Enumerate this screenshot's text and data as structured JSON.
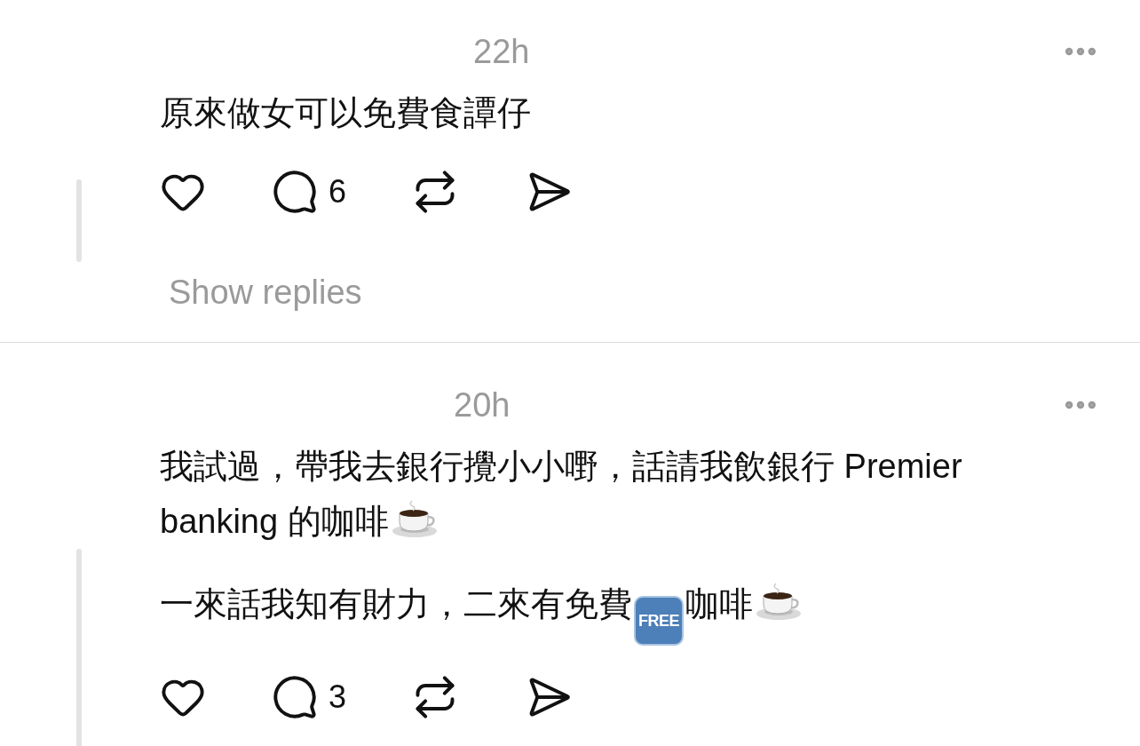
{
  "posts": [
    {
      "time": "22h",
      "paragraphs": [
        [
          [
            {
              "kind": "text",
              "text": "原來做女可以免費食譚仔"
            }
          ]
        ]
      ],
      "comments": "6",
      "show_replies": "Show replies"
    },
    {
      "time": "20h",
      "paragraphs": [
        [
          [
            {
              "kind": "text",
              "text": "我試過，帶我去銀行攪小小嘢，話請我飲銀行 Premier"
            }
          ],
          [
            {
              "kind": "text",
              "text": "banking 的咖啡"
            },
            {
              "kind": "coffee"
            }
          ]
        ],
        [
          [
            {
              "kind": "text",
              "text": "一來話我知有財力，二來有免費"
            },
            {
              "kind": "free",
              "text": "FREE"
            },
            {
              "kind": "text",
              "text": "咖啡"
            },
            {
              "kind": "coffee"
            }
          ]
        ]
      ],
      "comments": "3"
    }
  ]
}
